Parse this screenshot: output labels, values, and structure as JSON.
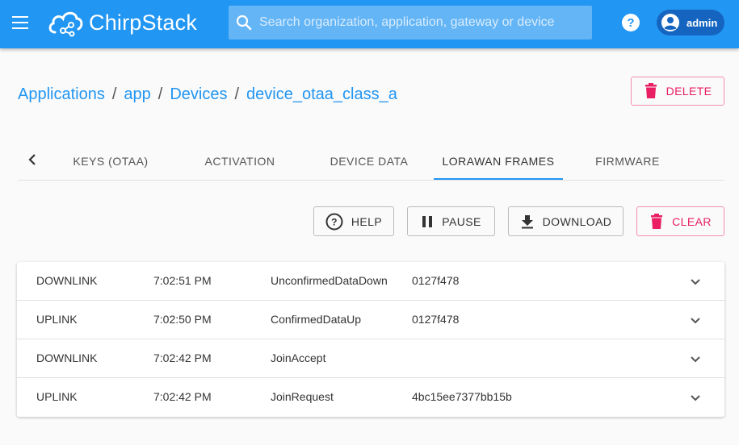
{
  "header": {
    "app_name": "ChirpStack",
    "search_placeholder": "Search organization, application, gateway or device",
    "user": "admin"
  },
  "breadcrumb": {
    "items": [
      "Applications",
      "app",
      "Devices",
      "device_otaa_class_a"
    ],
    "separator": "/"
  },
  "actions": {
    "delete_label": "DELETE"
  },
  "tabs": [
    {
      "label": "KEYS (OTAA)"
    },
    {
      "label": "ACTIVATION"
    },
    {
      "label": "DEVICE DATA"
    },
    {
      "label": "LORAWAN FRAMES",
      "active": true
    },
    {
      "label": "FIRMWARE"
    }
  ],
  "frame_actions": {
    "help_label": "HELP",
    "pause_label": "PAUSE",
    "download_label": "DOWNLOAD",
    "clear_label": "CLEAR"
  },
  "frames": [
    {
      "direction": "DOWNLINK",
      "time": "7:02:51 PM",
      "type": "UnconfirmedDataDown",
      "dev_addr": "0127f478"
    },
    {
      "direction": "UPLINK",
      "time": "7:02:50 PM",
      "type": "ConfirmedDataUp",
      "dev_addr": "0127f478"
    },
    {
      "direction": "DOWNLINK",
      "time": "7:02:42 PM",
      "type": "JoinAccept",
      "dev_addr": ""
    },
    {
      "direction": "UPLINK",
      "time": "7:02:42 PM",
      "type": "JoinRequest",
      "dev_addr": "4bc15ee7377bb15b"
    }
  ],
  "colors": {
    "primary": "#2196f3",
    "danger": "#e91e63",
    "user_chip": "#1565c0"
  },
  "icons": [
    "menu-icon",
    "chirpstack-cloud-icon",
    "search-icon",
    "help-circle-icon",
    "account-circle-icon",
    "delete-icon",
    "chevron-left-icon",
    "pause-icon",
    "download-icon",
    "chevron-down-icon"
  ]
}
